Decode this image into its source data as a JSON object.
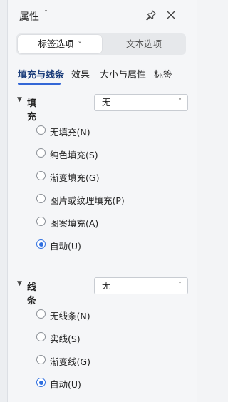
{
  "panel": {
    "title": "属性",
    "title_caret": "˅",
    "pin_icon": "pin-icon",
    "close_icon": "close-icon"
  },
  "mode_tabs": {
    "active_label": "标签选项",
    "active_caret": "˅",
    "inactive_label": "文本选项"
  },
  "tabs": [
    {
      "label": "填充与线条",
      "active": true
    },
    {
      "label": "效果",
      "active": false
    },
    {
      "label": "大小与属性",
      "active": false
    },
    {
      "label": "标签",
      "active": false
    }
  ],
  "fill": {
    "heading": "填充",
    "collapse_glyph": "▼",
    "select_value": "无",
    "select_caret": "˅",
    "options": [
      {
        "label": "无填充(N)",
        "checked": false
      },
      {
        "label": "纯色填充(S)",
        "checked": false
      },
      {
        "label": "渐变填充(G)",
        "checked": false
      },
      {
        "label": "图片或纹理填充(P)",
        "checked": false
      },
      {
        "label": "图案填充(A)",
        "checked": false
      },
      {
        "label": "自动(U)",
        "checked": true
      }
    ]
  },
  "line": {
    "heading": "线条",
    "collapse_glyph": "▼",
    "select_value": "无",
    "select_caret": "˅",
    "options": [
      {
        "label": "无线条(N)",
        "checked": false
      },
      {
        "label": "实线(S)",
        "checked": false
      },
      {
        "label": "渐变线(G)",
        "checked": false
      },
      {
        "label": "自动(U)",
        "checked": true
      }
    ]
  },
  "colors": {
    "accent": "#2f6fe0",
    "tab_underline": "#3367d6"
  }
}
